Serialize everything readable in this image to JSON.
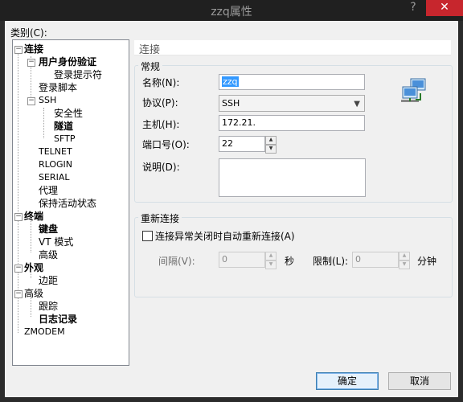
{
  "window": {
    "title": "zzq属性",
    "help": "?",
    "close": "✕"
  },
  "category_label": "类别(C):",
  "tree": {
    "connection": "连接",
    "user_auth": "用户身份验证",
    "login_prompt": "登录提示符",
    "login_script": "登录脚本",
    "ssh": "SSH",
    "security": "安全性",
    "tunnel": "隧道",
    "sftp": "SFTP",
    "telnet": "TELNET",
    "rlogin": "RLOGIN",
    "serial": "SERIAL",
    "proxy": "代理",
    "keepalive": "保持活动状态",
    "terminal": "终端",
    "keyboard": "键盘",
    "vt_mode": "VT 模式",
    "advanced_term": "高级",
    "appearance": "外观",
    "margin": "边距",
    "advanced": "高级",
    "trace": "跟踪",
    "log": "日志记录",
    "zmodem": "ZMODEM"
  },
  "section_title": "连接",
  "general": {
    "title": "常规",
    "name_label": "名称(N):",
    "name_value": "zzq",
    "protocol_label": "协议(P):",
    "protocol_value": "SSH",
    "host_label": "主机(H):",
    "host_value": "172.21.",
    "port_label": "端口号(O):",
    "port_value": "22",
    "desc_label": "说明(D):"
  },
  "reconnect": {
    "title": "重新连接",
    "checkbox_label": "连接异常关闭时自动重新连接(A)",
    "interval_label": "间隔(V):",
    "interval_value": "0",
    "interval_unit": "秒",
    "limit_label": "限制(L):",
    "limit_value": "0",
    "limit_unit": "分钟"
  },
  "buttons": {
    "ok": "确定",
    "cancel": "取消"
  },
  "icons": {
    "expand": "minus-box",
    "network": "network-computers-icon"
  },
  "colors": {
    "selection": "#3399ff",
    "close": "#c7262d",
    "default_button": "#3c7fb1"
  }
}
